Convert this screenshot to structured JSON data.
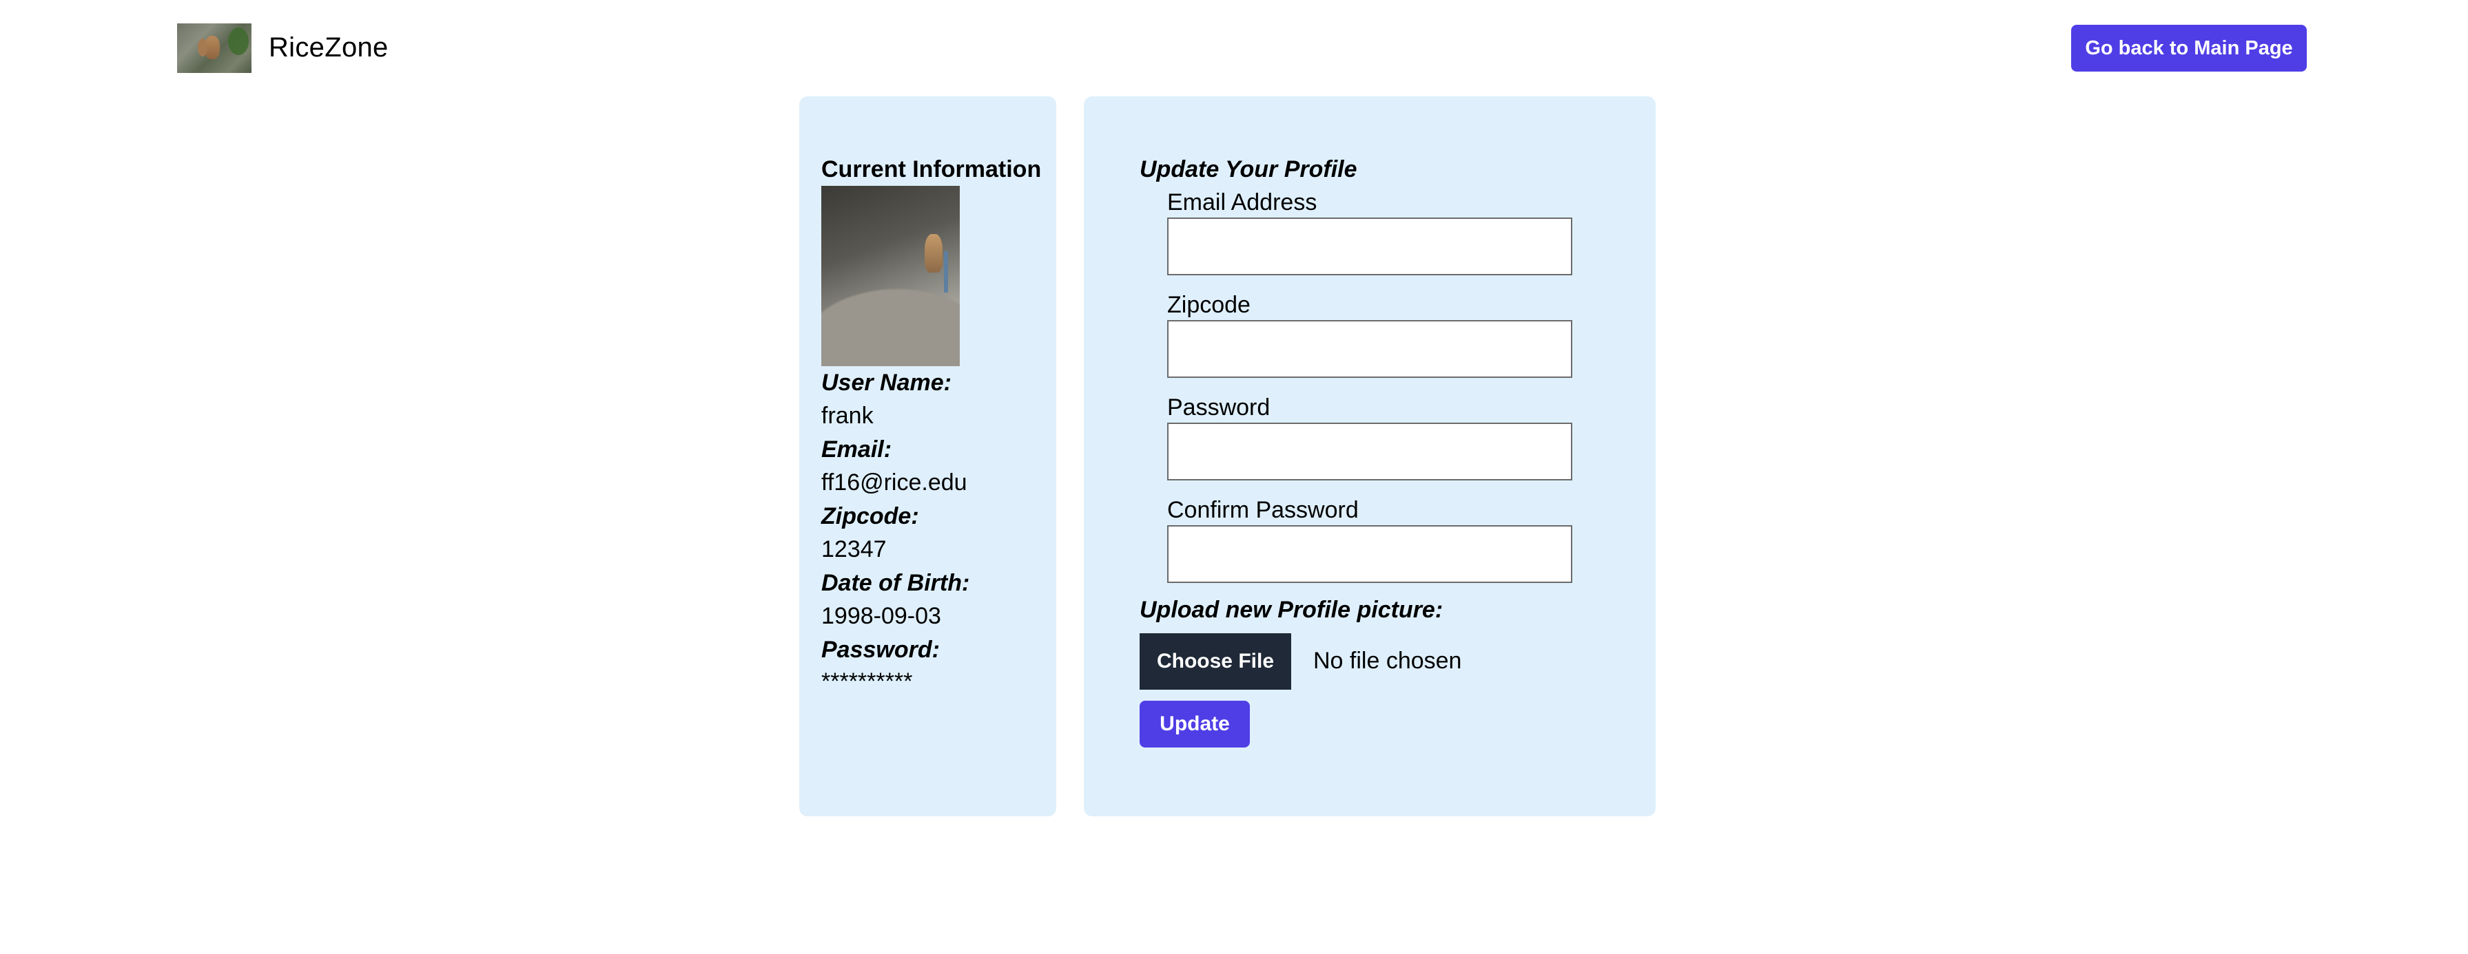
{
  "header": {
    "brand": "RiceZone",
    "back_button": "Go back to Main Page"
  },
  "current_info": {
    "title": "Current Information",
    "fields": [
      {
        "label": "User Name:",
        "value": "frank"
      },
      {
        "label": "Email:",
        "value": "ff16@rice.edu"
      },
      {
        "label": "Zipcode:",
        "value": "12347"
      },
      {
        "label": "Date of Birth:",
        "value": "1998-09-03"
      },
      {
        "label": "Password:",
        "value": "**********"
      }
    ]
  },
  "update_form": {
    "title": "Update Your Profile",
    "fields": [
      {
        "label": "Email Address",
        "value": ""
      },
      {
        "label": "Zipcode",
        "value": ""
      },
      {
        "label": "Password",
        "value": ""
      },
      {
        "label": "Confirm Password",
        "value": ""
      }
    ],
    "upload_title": "Upload new Profile picture:",
    "choose_file": "Choose File",
    "file_status": "No file chosen",
    "submit": "Update"
  },
  "colors": {
    "accent": "#4f3ee6",
    "panel_bg": "#dff0fc",
    "dark_button": "#1f2937"
  },
  "icons": {
    "logo": "squirrel-logo-image",
    "avatar": "profile-photo-image"
  }
}
